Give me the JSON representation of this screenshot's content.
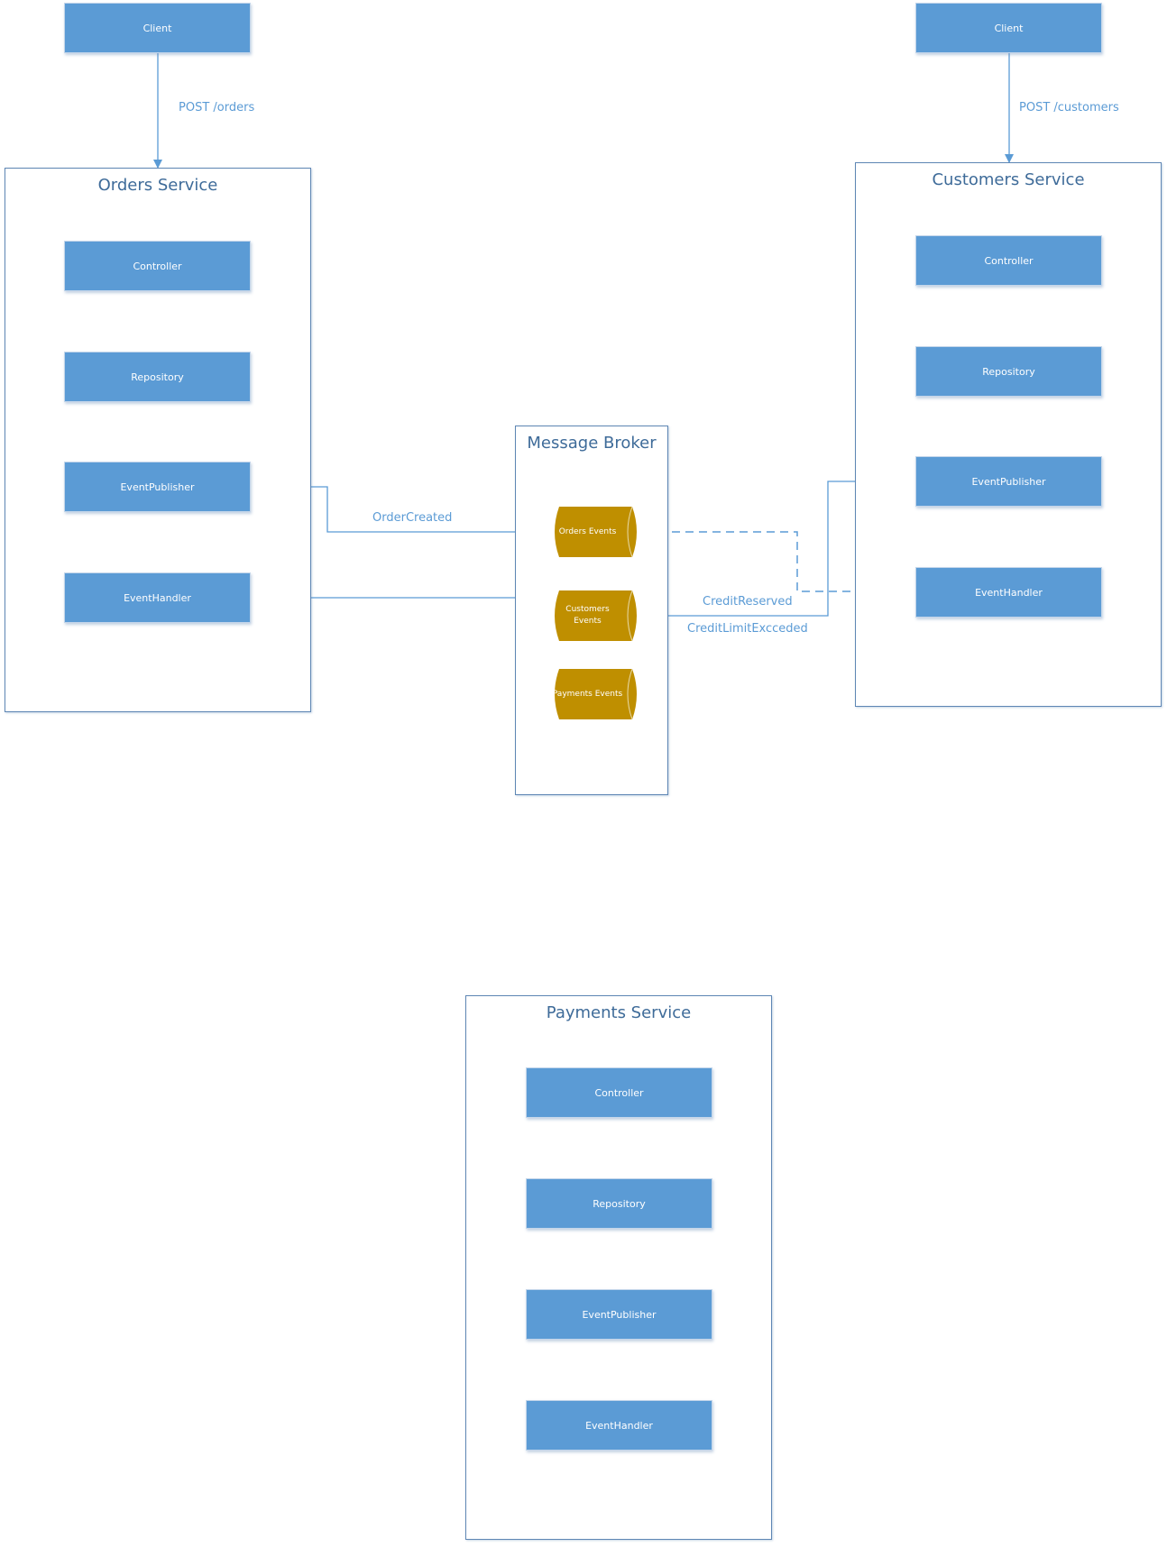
{
  "diagram": {
    "clients": [
      {
        "label": "Client",
        "request_label": "POST /orders"
      },
      {
        "label": "Client",
        "request_label": "POST /customers"
      }
    ],
    "services": {
      "orders": {
        "title": "Orders Service",
        "components": [
          "Controller",
          "Repository",
          "EventPublisher",
          "EventHandler"
        ]
      },
      "customers": {
        "title": "Customers Service",
        "components": [
          "Controller",
          "Repository",
          "EventPublisher",
          "EventHandler"
        ]
      },
      "payments": {
        "title": "Payments Service",
        "components": [
          "Controller",
          "Repository",
          "EventPublisher",
          "EventHandler"
        ]
      }
    },
    "broker": {
      "title": "Message Broker",
      "topics": [
        "Orders Events",
        "Customers Events",
        "Payments Events"
      ]
    },
    "edges": {
      "order_created": "OrderCreated",
      "credit_reserved": "CreditReserved",
      "credit_limit_exceeded": "CreditLimitExcceded"
    },
    "colors": {
      "component_fill": "#5B9BD5",
      "topic_fill": "#BF8F00",
      "container_border": "#5E86B4",
      "connector": "#5B9BD5"
    }
  }
}
